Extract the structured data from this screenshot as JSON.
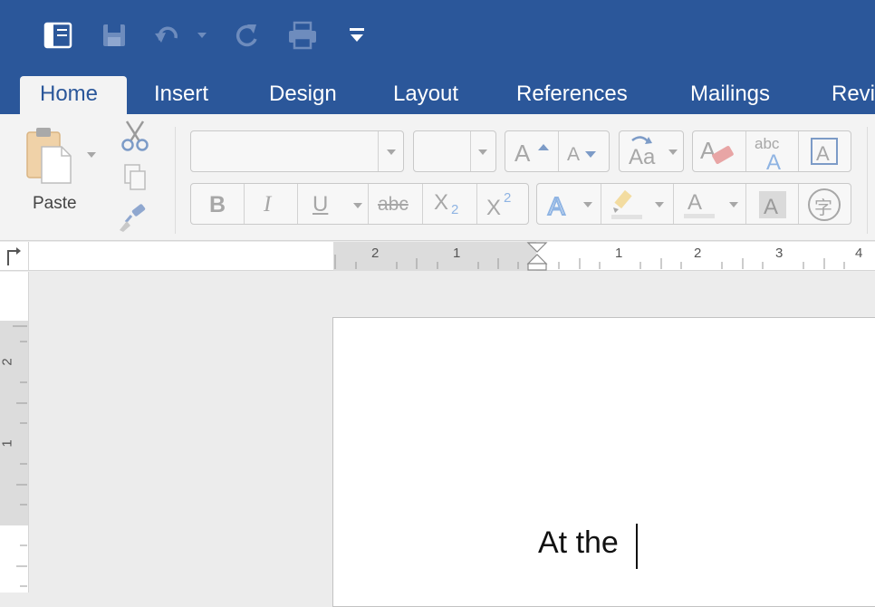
{
  "tabs": [
    "Home",
    "Insert",
    "Design",
    "Layout",
    "References",
    "Mailings",
    "Revi"
  ],
  "active_tab": "Home",
  "clipboard": {
    "paste_label": "Paste"
  },
  "font": {
    "font_name_value": "",
    "font_size_value": ""
  },
  "font_buttons": {
    "spelling_label": "abc",
    "bold": "B",
    "italic": "I",
    "underline": "U",
    "strikethrough": "abc",
    "subscript": "X",
    "subscript_mark": "2",
    "superscript": "X",
    "superscript_mark": "2",
    "phonetic_char": "字"
  },
  "rulers": {
    "horizontal_numbers": [
      "2",
      "1",
      "1",
      "2",
      "3",
      "4"
    ],
    "vertical_numbers": [
      "2",
      "1"
    ]
  },
  "document": {
    "text": "At the"
  },
  "colors": {
    "accent": "#2b579a",
    "ribbon": "#f3f3f3",
    "disabled": "#a7a7a7"
  }
}
